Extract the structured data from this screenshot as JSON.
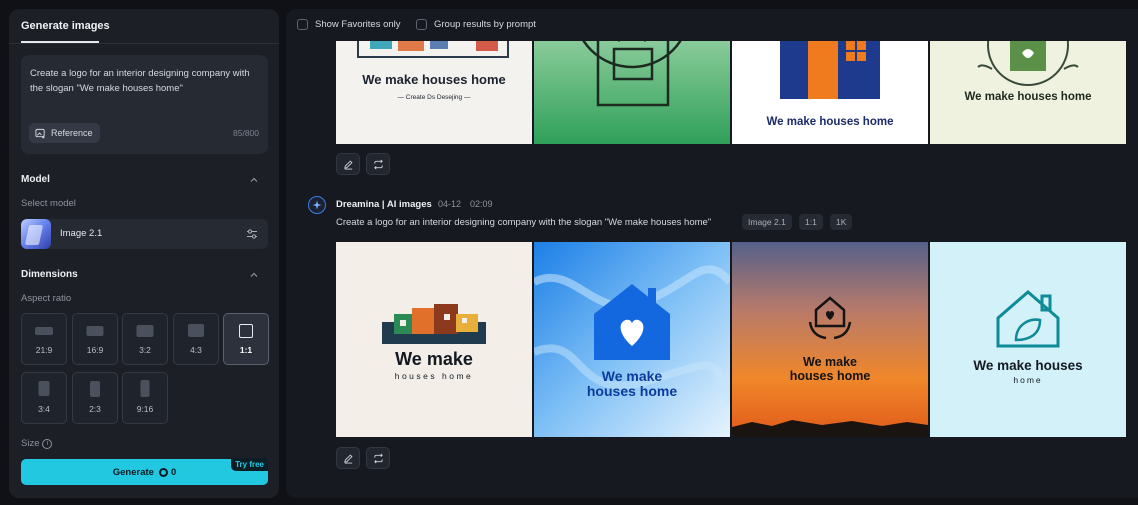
{
  "sidebar": {
    "tab_label": "Generate images",
    "prompt": {
      "text": "Create a logo for an interior designing company with the slogan \"We make houses home\"",
      "reference_label": "Reference",
      "counter": "85/800"
    },
    "model_section": {
      "title": "Model",
      "select_label": "Select model",
      "selected_model": "Image 2.1"
    },
    "dimensions_section": {
      "title": "Dimensions",
      "aspect_label": "Aspect ratio",
      "ratios": [
        "21:9",
        "16:9",
        "3:2",
        "4:3",
        "1:1",
        "3:4",
        "2:3",
        "9:16"
      ],
      "selected_ratio": "1:1",
      "size_label": "Size"
    },
    "generate": {
      "label": "Generate",
      "cost": "0",
      "badge": "Try free"
    }
  },
  "toolbar": {
    "show_favorites": "Show Favorites only",
    "group_by_prompt": "Group results by prompt"
  },
  "results": {
    "top_group_images": [
      {
        "text": "We make houses home",
        "subtext": "— Create Ds Desejing —"
      },
      {
        "text": ""
      },
      {
        "text": "We make houses home"
      },
      {
        "text": "We make houses home"
      }
    ],
    "group": {
      "source": "Dreamina | AI images",
      "date": "04-12",
      "time": "02:09",
      "prompt": "Create a logo for an interior designing company with the slogan \"We make houses home\"",
      "tags": [
        "Image 2.1",
        "1:1",
        "1K"
      ],
      "images": [
        {
          "line1": "We make",
          "line2": "houses home"
        },
        {
          "line1": "We make",
          "line2": "houses home"
        },
        {
          "line1": "We make",
          "line2": "houses home"
        },
        {
          "line1": "We make houses",
          "line2": "home"
        }
      ]
    }
  },
  "colors": {
    "accent": "#22c8e0",
    "panel": "#1c1f26",
    "background": "#0f1116"
  }
}
